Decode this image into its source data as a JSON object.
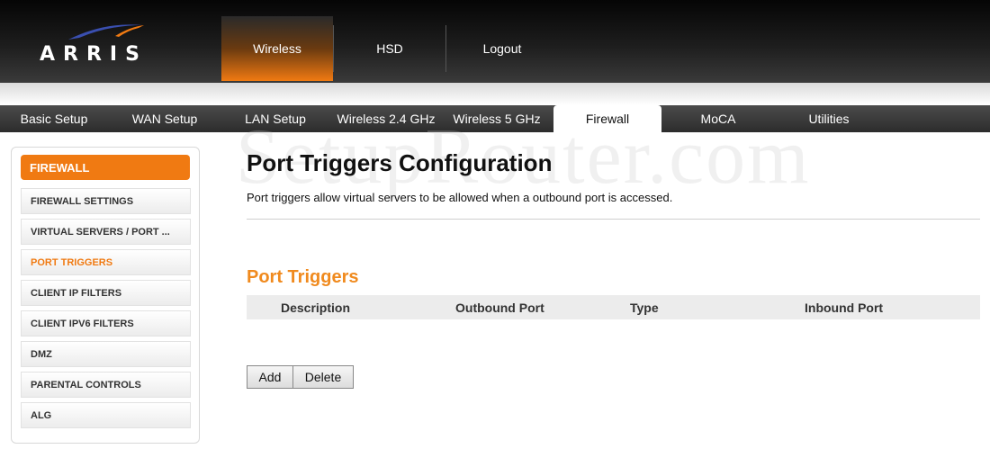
{
  "brand": {
    "logo_text": "ARRIS",
    "swoosh_color": "#f07a12",
    "swoosh_accent": "#3a4fb0"
  },
  "top_nav": [
    {
      "label": "Wireless",
      "active": true
    },
    {
      "label": "HSD",
      "active": false
    },
    {
      "label": "Logout",
      "active": false
    }
  ],
  "tabs": [
    {
      "label": "Basic Setup",
      "active": false
    },
    {
      "label": "WAN Setup",
      "active": false
    },
    {
      "label": "LAN Setup",
      "active": false
    },
    {
      "label": "Wireless 2.4 GHz",
      "active": false
    },
    {
      "label": "Wireless 5 GHz",
      "active": false
    },
    {
      "label": "Firewall",
      "active": true
    },
    {
      "label": "MoCA",
      "active": false
    },
    {
      "label": "Utilities",
      "active": false
    }
  ],
  "watermark": "SetupRouter.com",
  "sidebar": {
    "title": "FIREWALL",
    "items": [
      {
        "label": "FIREWALL SETTINGS",
        "active": false
      },
      {
        "label": "VIRTUAL SERVERS / PORT ...",
        "active": false
      },
      {
        "label": "PORT TRIGGERS",
        "active": true
      },
      {
        "label": "CLIENT IP FILTERS",
        "active": false
      },
      {
        "label": "CLIENT IPV6 FILTERS",
        "active": false
      },
      {
        "label": "DMZ",
        "active": false
      },
      {
        "label": "PARENTAL CONTROLS",
        "active": false
      },
      {
        "label": "ALG",
        "active": false
      }
    ]
  },
  "main": {
    "title": "Port Triggers Configuration",
    "description": "Port triggers allow virtual servers to be allowed when a outbound port is accessed.",
    "section_title": "Port Triggers",
    "table_headers": [
      "Description",
      "Outbound Port",
      "Type",
      "Inbound Port"
    ],
    "buttons": {
      "add": "Add",
      "delete": "Delete"
    }
  },
  "colors": {
    "accent": "#f07a12",
    "section_title": "#f08a1e"
  }
}
